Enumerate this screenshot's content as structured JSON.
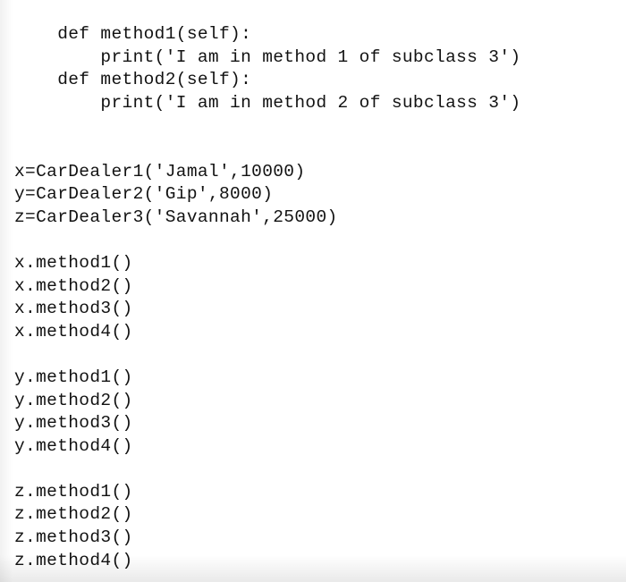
{
  "editor": {
    "language": "python",
    "background_color": "#ffffff",
    "text_color": "#121212",
    "indent_unit": "    ",
    "line_count": 22
  },
  "code": {
    "lines": [
      "    def method1(self):",
      "        print('I am in method 1 of subclass 3')",
      "    def method2(self):",
      "        print('I am in method 2 of subclass 3')",
      "",
      "",
      "x=CarDealer1('Jamal',10000)",
      "y=CarDealer2('Gip',8000)",
      "z=CarDealer3('Savannah',25000)",
      "",
      "x.method1()",
      "x.method2()",
      "x.method3()",
      "x.method4()",
      "",
      "y.method1()",
      "y.method2()",
      "y.method3()",
      "y.method4()",
      "",
      "z.method1()",
      "z.method2()",
      "z.method3()",
      "z.method4()"
    ],
    "method_definitions": [
      {
        "name": "method1",
        "params": "self",
        "body": "print('I am in method 1 of subclass 3')"
      },
      {
        "name": "method2",
        "params": "self",
        "body": "print('I am in method 2 of subclass 3')"
      }
    ],
    "instantiations": [
      {
        "variable": "x",
        "class": "CarDealer1",
        "name": "Jamal",
        "value": "10000"
      },
      {
        "variable": "y",
        "class": "CarDealer2",
        "name": "Gip",
        "value": "8000"
      },
      {
        "variable": "z",
        "class": "CarDealer3",
        "name": "Savannah",
        "value": "25000"
      }
    ],
    "method_calls": [
      "x.method1()",
      "x.method2()",
      "x.method3()",
      "x.method4()",
      "y.method1()",
      "y.method2()",
      "y.method3()",
      "y.method4()",
      "z.method1()",
      "z.method2()",
      "z.method3()",
      "z.method4()"
    ]
  }
}
